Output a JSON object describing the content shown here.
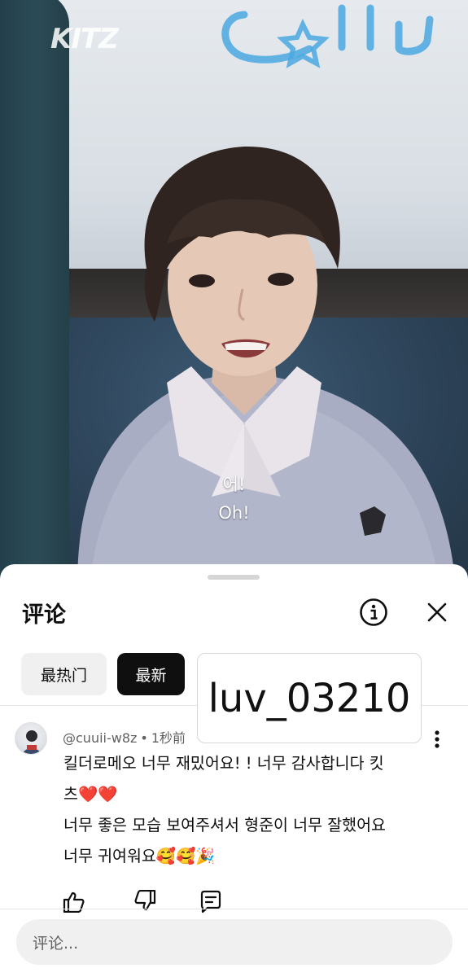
{
  "video": {
    "brand_logo": "KITZ",
    "subtitle_ko": "어!",
    "subtitle_en": "Oh!"
  },
  "comments_panel": {
    "title": "评论",
    "info_icon": "info-icon",
    "close_icon": "close-icon",
    "sort_chips": [
      {
        "label": "最热门",
        "selected": false
      },
      {
        "label": "最新",
        "selected": true
      }
    ],
    "overlay_tag": "luv_03210",
    "comment": {
      "author": "@cuuii-w8z",
      "separator": "•",
      "time": "1秒前",
      "lines": [
        "킬더로메오 너무 재밌어요! ! 너무 감사합니다 킷",
        "츠❤️❤️",
        "너무 좋은 모습 보여주셔서 형준이 너무 잘했어요",
        "너무 귀여워요🥰🥰🎉"
      ],
      "actions": [
        "thumbs-up-icon",
        "thumbs-down-icon",
        "reply-icon"
      ]
    },
    "composer_placeholder": "评论..."
  },
  "colors": {
    "sheet_bg": "#ffffff",
    "chip_selected_bg": "#0f0f0f",
    "chip_bg": "#f0f0f0",
    "meta_text": "#606060",
    "text": "#0f0f0f"
  }
}
